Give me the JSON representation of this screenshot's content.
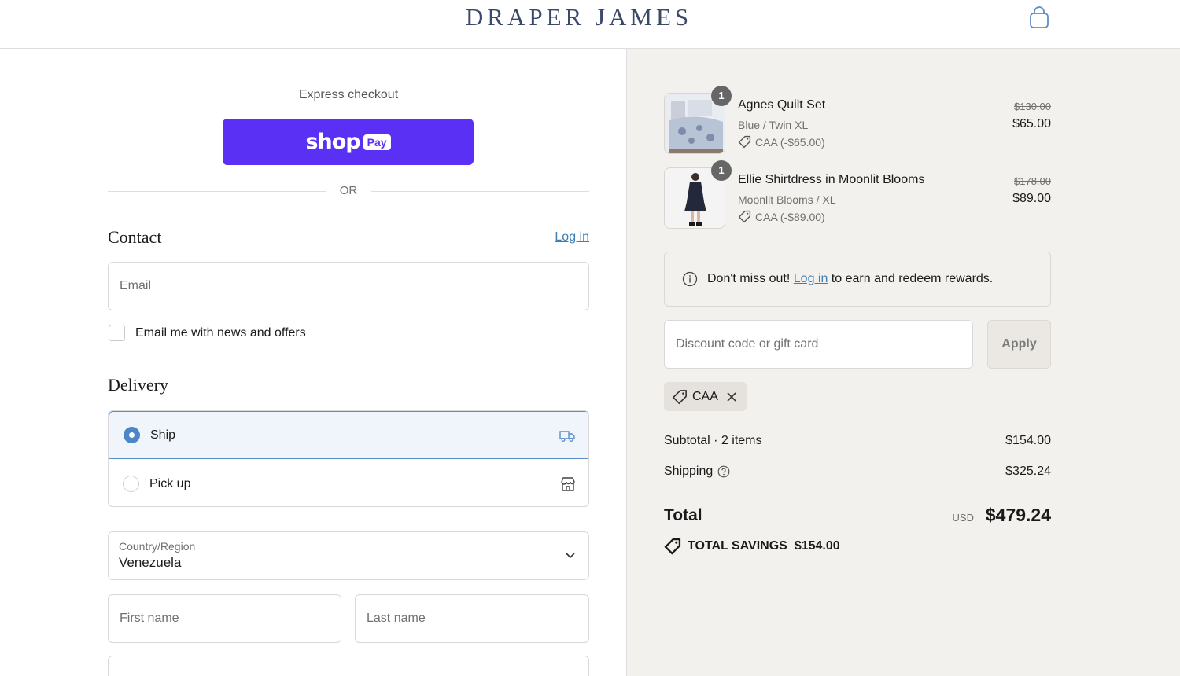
{
  "header": {
    "brand": "DRAPER JAMES"
  },
  "express": {
    "label": "Express checkout",
    "shop_label": "shop",
    "pay_label": "Pay",
    "or_label": "OR"
  },
  "contact": {
    "title": "Contact",
    "login_label": "Log in",
    "email_placeholder": "Email",
    "news_label": "Email me with news and offers"
  },
  "delivery": {
    "title": "Delivery",
    "options": [
      {
        "label": "Ship",
        "selected": true,
        "icon": "truck-icon"
      },
      {
        "label": "Pick up",
        "selected": false,
        "icon": "store-icon"
      }
    ],
    "country_label": "Country/Region",
    "country_value": "Venezuela",
    "first_name_placeholder": "First name",
    "last_name_placeholder": "Last name"
  },
  "order": {
    "items": [
      {
        "qty": "1",
        "title": "Agnes Quilt Set",
        "variant": "Blue / Twin XL",
        "discount": "CAA (-$65.00)",
        "old_price": "$130.00",
        "price": "$65.00"
      },
      {
        "qty": "1",
        "title": "Ellie Shirtdress in Moonlit Blooms",
        "variant": "Moonlit Blooms / XL",
        "discount": "CAA (-$89.00)",
        "old_price": "$178.00",
        "price": "$89.00"
      }
    ],
    "rewards_prefix": "Don't miss out! ",
    "rewards_link": "Log in",
    "rewards_suffix": " to earn and redeem rewards.",
    "discount_placeholder": "Discount code or gift card",
    "apply_label": "Apply",
    "applied_code": "CAA",
    "subtotal_label": "Subtotal · 2 items",
    "subtotal_value": "$154.00",
    "shipping_label": "Shipping",
    "shipping_value": "$325.24",
    "total_label": "Total",
    "currency": "USD",
    "total_value": "$479.24",
    "savings_label": "TOTAL SAVINGS",
    "savings_value": "$154.00"
  },
  "colors": {
    "shop_pay": "#5a31f4",
    "link": "#3d7fb5",
    "brand": "#3c4868",
    "summary_bg": "#f3f1ee"
  }
}
